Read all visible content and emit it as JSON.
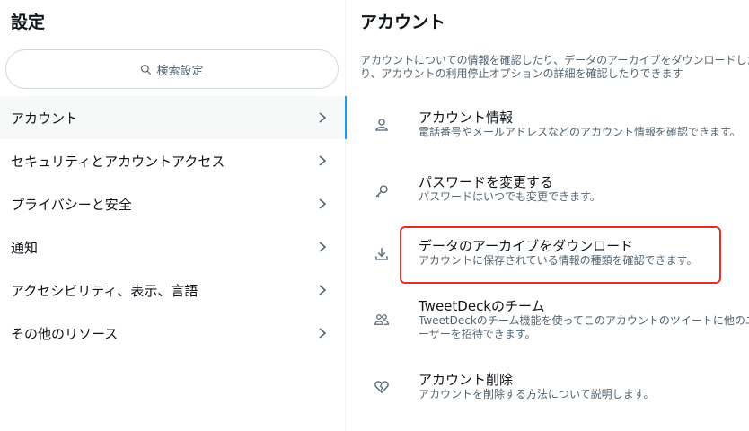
{
  "left": {
    "title": "設定",
    "search_label": "検索設定",
    "menu": [
      {
        "label": "アカウント",
        "active": true
      },
      {
        "label": "セキュリティとアカウントアクセス"
      },
      {
        "label": "プライバシーと安全"
      },
      {
        "label": "通知"
      },
      {
        "label": "アクセシビリティ、表示、言語"
      },
      {
        "label": "その他のリソース"
      }
    ]
  },
  "right": {
    "title": "アカウント",
    "description": "アカウントについての情報を確認したり、データのアーカイブをダウンロードしたり、アカウントの利用停止オプションの詳細を確認したりできます",
    "options": [
      {
        "icon": "person-icon",
        "title": "アカウント情報",
        "subtitle": "電話番号やメールアドレスなどのアカウント情報を確認できます。"
      },
      {
        "icon": "key-icon",
        "title": "パスワードを変更する",
        "subtitle": "パスワードはいつでも変更できます。"
      },
      {
        "icon": "download-icon",
        "title": "データのアーカイブをダウンロード",
        "subtitle": "アカウントに保存されている情報の種類を確認できます。"
      },
      {
        "icon": "team-icon",
        "title": "TweetDeckのチーム",
        "subtitle": "TweetDeckのチーム機能を使ってこのアカウントのツイートに他のユーザーを招待できます。"
      },
      {
        "icon": "broken-heart-icon",
        "title": "アカウント削除",
        "subtitle": "アカウントを削除する方法について説明します。"
      }
    ]
  },
  "colors": {
    "accent": "#1d9bf0",
    "highlight": "#e0302a",
    "muted_text": "#536471"
  }
}
